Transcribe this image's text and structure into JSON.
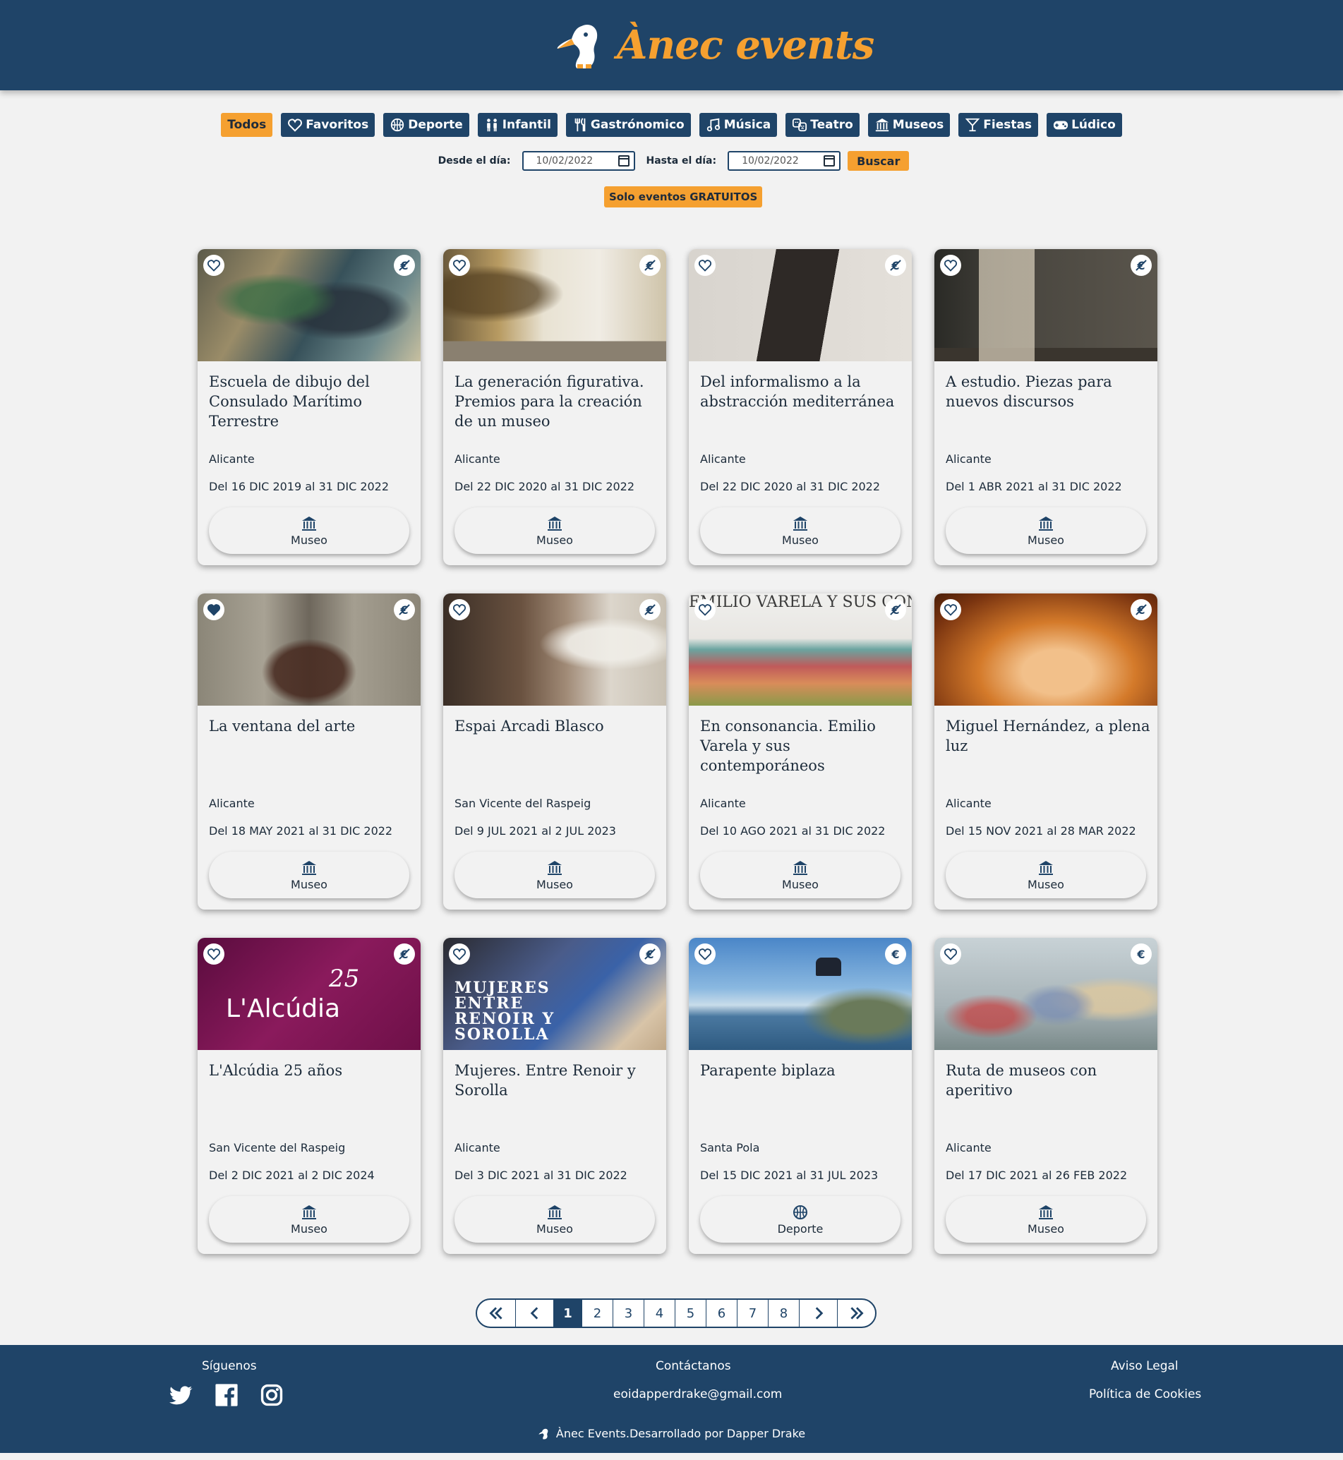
{
  "header": {
    "brand": "Ànec events"
  },
  "categories": [
    {
      "label": "Todos",
      "icon": "none",
      "active": true
    },
    {
      "label": "Favoritos",
      "icon": "heart-icon"
    },
    {
      "label": "Deporte",
      "icon": "ball-icon"
    },
    {
      "label": "Infantil",
      "icon": "children-icon"
    },
    {
      "label": "Gastrónomico",
      "icon": "cutlery-icon"
    },
    {
      "label": "Música",
      "icon": "music-icon"
    },
    {
      "label": "Teatro",
      "icon": "masks-icon"
    },
    {
      "label": "Museos",
      "icon": "museum-icon"
    },
    {
      "label": "Fiestas",
      "icon": "cocktail-icon"
    },
    {
      "label": "Lúdico",
      "icon": "gamepad-icon"
    }
  ],
  "filters": {
    "from_label": "Desde el día:",
    "from_value": "10/02/2022",
    "to_label": "Hasta el día:",
    "to_value": "10/02/2022",
    "search_label": "Buscar",
    "free_label": "Solo eventos GRATUITOS"
  },
  "events": [
    {
      "title": "Escuela de dibujo del Consulado Marítimo Terrestre",
      "city": "Alicante",
      "dates": "Del 16 DIC 2019 al 31 DIC 2022",
      "category": "Museo",
      "favorite": false,
      "price": "free"
    },
    {
      "title": "La generación figurativa. Premios para la creación de un museo",
      "city": "Alicante",
      "dates": "Del 22 DIC 2020 al 31 DIC 2022",
      "category": "Museo",
      "favorite": false,
      "price": "free"
    },
    {
      "title": "Del informalismo a la abstracción mediterránea",
      "city": "Alicante",
      "dates": "Del 22 DIC 2020 al 31 DIC 2022",
      "category": "Museo",
      "favorite": false,
      "price": "free"
    },
    {
      "title": "A estudio. Piezas para nuevos discursos",
      "city": "Alicante",
      "dates": "Del 1 ABR 2021 al 31 DIC 2022",
      "category": "Museo",
      "favorite": false,
      "price": "free"
    },
    {
      "title": "La ventana del arte",
      "city": "Alicante",
      "dates": "Del 18 MAY 2021 al 31 DIC 2022",
      "category": "Museo",
      "favorite": true,
      "price": "free"
    },
    {
      "title": "Espai Arcadi Blasco",
      "city": "San Vicente del Raspeig",
      "dates": "Del 9 JUL 2021 al 2 JUL 2023",
      "category": "Museo",
      "favorite": false,
      "price": "free"
    },
    {
      "title": "En consonancia. Emilio Varela y sus contemporáneos",
      "city": "Alicante",
      "dates": "Del 10 AGO 2021 al 31 DIC 2022",
      "category": "Museo",
      "favorite": false,
      "price": "free",
      "image_text": "EMILIO VARELA Y SUS CONTEMPORÁNEOS"
    },
    {
      "title": "Miguel Hernández, a plena luz",
      "city": "Alicante",
      "dates": "Del 15 NOV 2021 al 28 MAR 2022",
      "category": "Museo",
      "favorite": false,
      "price": "free"
    },
    {
      "title": "L'Alcúdia 25 años",
      "city": "San Vicente del Raspeig",
      "dates": "Del 2 DIC 2021 al 2 DIC 2024",
      "category": "Museo",
      "favorite": false,
      "price": "free",
      "image_text": "L'Alcúdia"
    },
    {
      "title": "Mujeres. Entre Renoir y Sorolla",
      "city": "Alicante",
      "dates": "Del 3 DIC 2021 al 31 DIC 2022",
      "category": "Museo",
      "favorite": false,
      "price": "free",
      "image_text": "MUJERES ENTRE RENOIR Y SOROLLA"
    },
    {
      "title": "Parapente biplaza",
      "city": "Santa Pola",
      "dates": "Del 15 DIC 2021 al 31 JUL 2023",
      "category": "Deporte",
      "favorite": false,
      "price": "paid"
    },
    {
      "title": "Ruta de museos con aperitivo",
      "city": "Alicante",
      "dates": "Del 17 DIC 2021 al 26 FEB 2022",
      "category": "Museo",
      "favorite": false,
      "price": "paid"
    }
  ],
  "pagination": {
    "pages": [
      "1",
      "2",
      "3",
      "4",
      "5",
      "6",
      "7",
      "8"
    ],
    "current": "1"
  },
  "footer": {
    "follow_label": "Síguenos",
    "contact_label": "Contáctanos",
    "email": "eoidapperdrake@gmail.com",
    "legal_label": "Aviso Legal",
    "cookies_label": "Política de Cookies",
    "credit": "Ànec Events.Desarrollado por Dapper Drake",
    "social": [
      "twitter-icon",
      "facebook-icon",
      "instagram-icon"
    ]
  },
  "colors": {
    "primary": "#1f4468",
    "accent": "#f5a030",
    "background": "#f2f2f2"
  }
}
